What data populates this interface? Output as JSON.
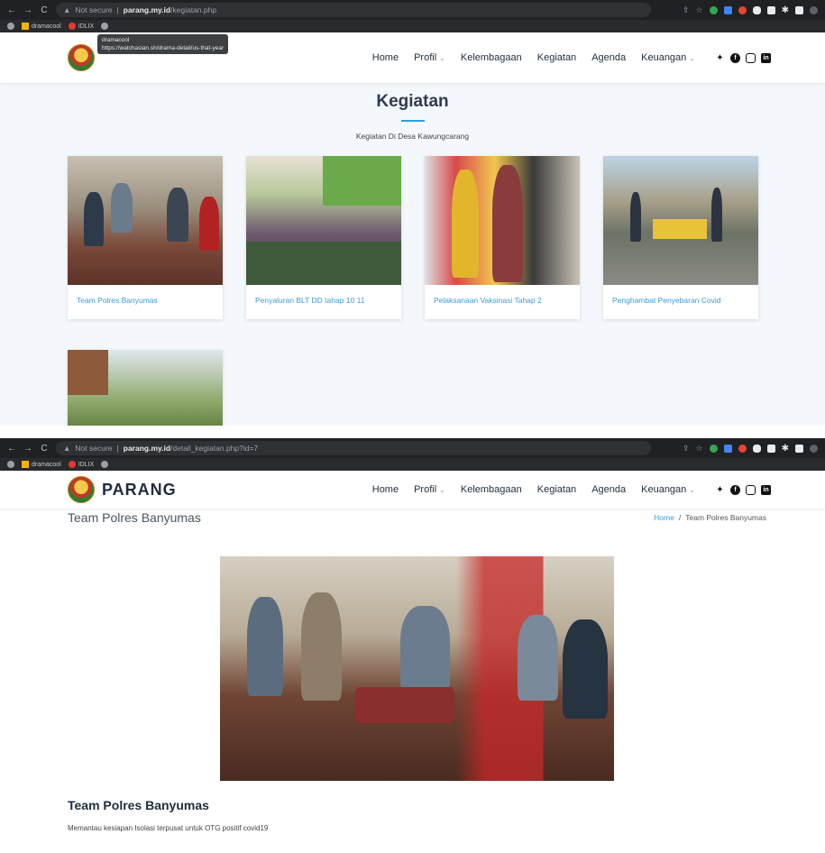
{
  "screen1": {
    "browser": {
      "security_label": "Not secure",
      "url_host": "parang.my.id",
      "url_path": "/kegiatan.php",
      "bookmarks": [
        {
          "label": "dramacool",
          "color": "#4c8bf5"
        },
        {
          "label": "IDLIX",
          "color": "#e53935"
        }
      ]
    },
    "tooltip": {
      "title": "dramacool",
      "url": "https://watchasian.sh/drama-detail/us-that-year"
    },
    "nav": {
      "items": [
        "Home",
        "Profil",
        "Kelembagaan",
        "Kegiatan",
        "Agenda",
        "Keuangan"
      ]
    },
    "section": {
      "title": "Kegiatan",
      "subtitle": "Kegiatan Di Desa Kawungcarang"
    },
    "cards": [
      {
        "caption": "Team Polres Banyumas"
      },
      {
        "caption": "Penyaluran BLT DD tahap 10 11"
      },
      {
        "caption": "Pelaksanaan Vaksinasi Tahap 2"
      },
      {
        "caption": "Penghambat Penyebaran Covid"
      },
      {
        "caption": ""
      }
    ]
  },
  "screen2": {
    "browser": {
      "security_label": "Not secure",
      "url_host": "parang.my.id",
      "url_path": "/detail_kegiatan.php?id=7",
      "bookmarks": [
        {
          "label": "dramacool",
          "color": "#4c8bf5"
        },
        {
          "label": "IDLIX",
          "color": "#e53935"
        }
      ]
    },
    "brand": "PARANG",
    "nav": {
      "items": [
        "Home",
        "Profil",
        "Kelembagaan",
        "Kegiatan",
        "Agenda",
        "Keuangan"
      ]
    },
    "page_heading": "Team Polres Banyumas",
    "breadcrumb": {
      "home": "Home",
      "separator": "/",
      "current": "Team Polres Banyumas"
    },
    "detail": {
      "title": "Team Polres Banyumas",
      "description": "Memantau kesiapan Isolasi terpusat untuk OTG positif covid19"
    }
  },
  "social_icons": [
    "twitter-icon",
    "facebook-icon",
    "instagram-icon",
    "linkedin-icon"
  ],
  "accent_color": "#2e9de0",
  "link_color": "#3a9bd8"
}
